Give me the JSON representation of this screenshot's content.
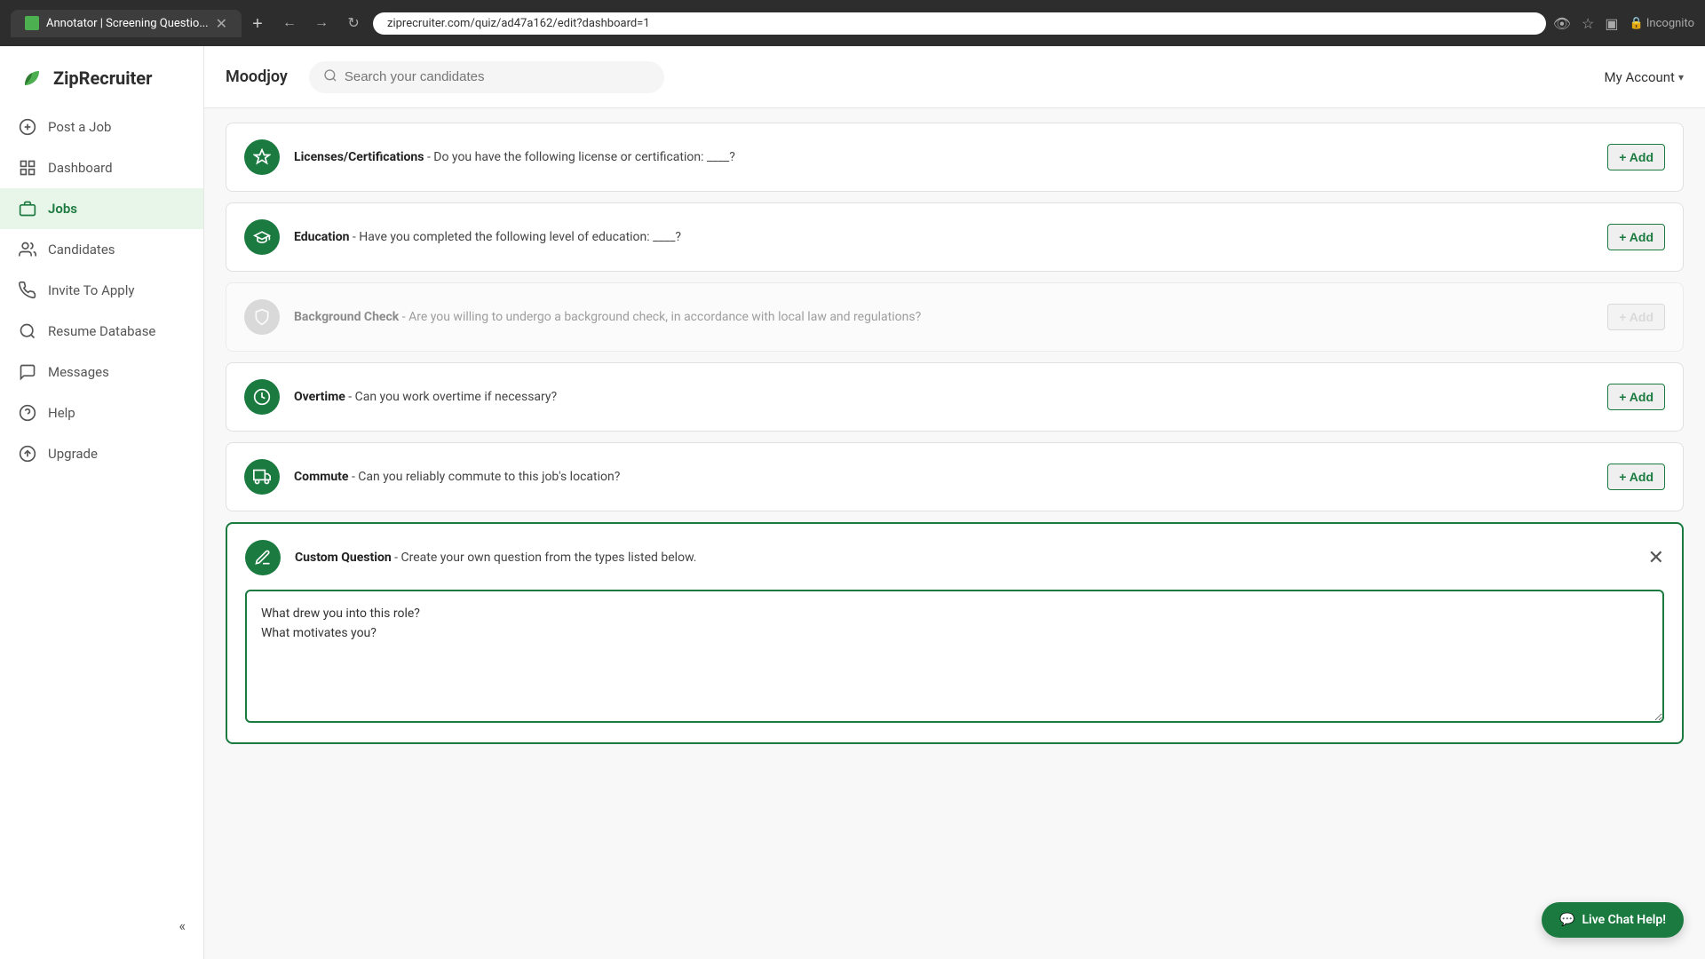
{
  "browser": {
    "url": "ziprecruiter.com/quiz/ad47a162/edit?dashboard=1",
    "tab_title": "Annotator | Screening Questio...",
    "back_label": "←",
    "forward_label": "→",
    "refresh_label": "↻"
  },
  "header": {
    "company_name": "Moodjoy",
    "search_placeholder": "Search your candidates",
    "my_account_label": "My Account"
  },
  "sidebar": {
    "logo_text": "ZipRecruiter",
    "nav_items": [
      {
        "id": "post-job",
        "label": "Post a Job"
      },
      {
        "id": "dashboard",
        "label": "Dashboard"
      },
      {
        "id": "jobs",
        "label": "Jobs",
        "active": true
      },
      {
        "id": "candidates",
        "label": "Candidates"
      },
      {
        "id": "invite-to-apply",
        "label": "Invite To Apply"
      },
      {
        "id": "resume-database",
        "label": "Resume Database"
      },
      {
        "id": "messages",
        "label": "Messages"
      },
      {
        "id": "help",
        "label": "Help"
      },
      {
        "id": "upgrade",
        "label": "Upgrade"
      }
    ]
  },
  "questions": [
    {
      "id": "licenses",
      "label": "Licenses/Certifications",
      "text": " - Do you have the following license or certification: ____?",
      "icon_type": "green",
      "icon": "badge",
      "add_label": "+ Add",
      "disabled": false
    },
    {
      "id": "education",
      "label": "Education",
      "text": " - Have you completed the following level of education: ____?",
      "icon_type": "green",
      "icon": "graduation",
      "add_label": "+ Add",
      "disabled": false
    },
    {
      "id": "background",
      "label": "Background Check",
      "text": " - Are you willing to undergo a background check, in accordance with local law and regulations?",
      "icon_type": "gray",
      "icon": "shield",
      "add_label": "+ Add",
      "disabled": true
    },
    {
      "id": "overtime",
      "label": "Overtime",
      "text": " - Can you work overtime if necessary?",
      "icon_type": "green",
      "icon": "clock",
      "add_label": "+ Add",
      "disabled": false
    },
    {
      "id": "commute",
      "label": "Commute",
      "text": " - Can you reliably commute to this job's location?",
      "icon_type": "green",
      "icon": "car",
      "add_label": "+ Add",
      "disabled": false
    }
  ],
  "custom_question": {
    "label": "Custom Question",
    "text": " - Create your own question from the types listed below.",
    "textarea_value": "What drew you into this role?\nWhat motivates you?"
  },
  "live_chat": {
    "label": "Live Chat Help!"
  }
}
